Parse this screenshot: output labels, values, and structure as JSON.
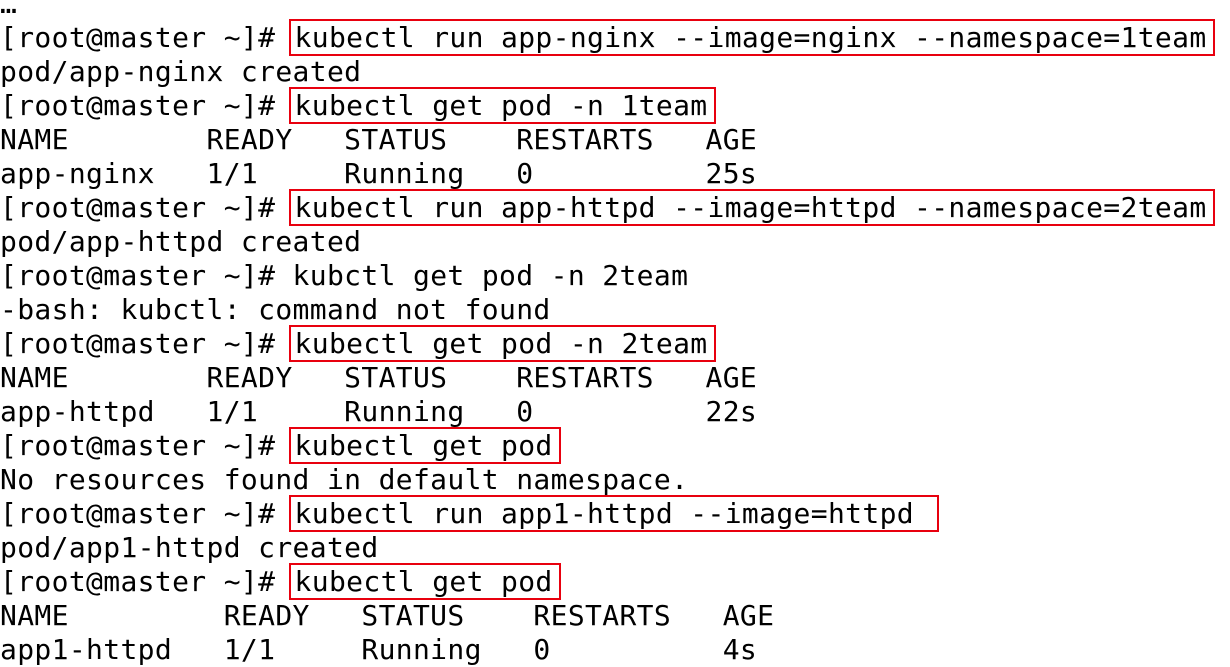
{
  "terminal": {
    "highlight_color": "#e8000e",
    "lines": [
      {
        "type": "output",
        "text": "…"
      },
      {
        "type": "prompt",
        "prompt": "[root@master ~]# ",
        "cmd": "kubectl run app-nginx --image=nginx --namespace=1team",
        "boxed": true
      },
      {
        "type": "output",
        "text": "pod/app-nginx created"
      },
      {
        "type": "prompt",
        "prompt": "[root@master ~]# ",
        "cmd": "kubectl get pod -n 1team",
        "boxed": true
      },
      {
        "type": "output",
        "text": "NAME        READY   STATUS    RESTARTS   AGE"
      },
      {
        "type": "output",
        "text": "app-nginx   1/1     Running   0          25s"
      },
      {
        "type": "prompt",
        "prompt": "[root@master ~]# ",
        "cmd": "kubectl run app-httpd --image=httpd --namespace=2team",
        "boxed": true
      },
      {
        "type": "output",
        "text": "pod/app-httpd created"
      },
      {
        "type": "prompt",
        "prompt": "[root@master ~]# ",
        "cmd": "kubctl get pod -n 2team",
        "boxed": false
      },
      {
        "type": "output",
        "text": "-bash: kubctl: command not found"
      },
      {
        "type": "prompt",
        "prompt": "[root@master ~]# ",
        "cmd": "kubectl get pod -n 2team",
        "boxed": true
      },
      {
        "type": "output",
        "text": "NAME        READY   STATUS    RESTARTS   AGE"
      },
      {
        "type": "output",
        "text": "app-httpd   1/1     Running   0          22s"
      },
      {
        "type": "prompt",
        "prompt": "[root@master ~]# ",
        "cmd": "kubectl get pod",
        "boxed": true
      },
      {
        "type": "output",
        "text": "No resources found in default namespace."
      },
      {
        "type": "prompt",
        "prompt": "[root@master ~]# ",
        "cmd": "kubectl run app1-httpd --image=httpd ",
        "boxed": true
      },
      {
        "type": "output",
        "text": "pod/app1-httpd created"
      },
      {
        "type": "prompt",
        "prompt": "[root@master ~]# ",
        "cmd": "kubectl get pod",
        "boxed": true
      },
      {
        "type": "output",
        "text": "NAME         READY   STATUS    RESTARTS   AGE"
      },
      {
        "type": "output",
        "text": "app1-httpd   1/1     Running   0          4s"
      }
    ]
  }
}
